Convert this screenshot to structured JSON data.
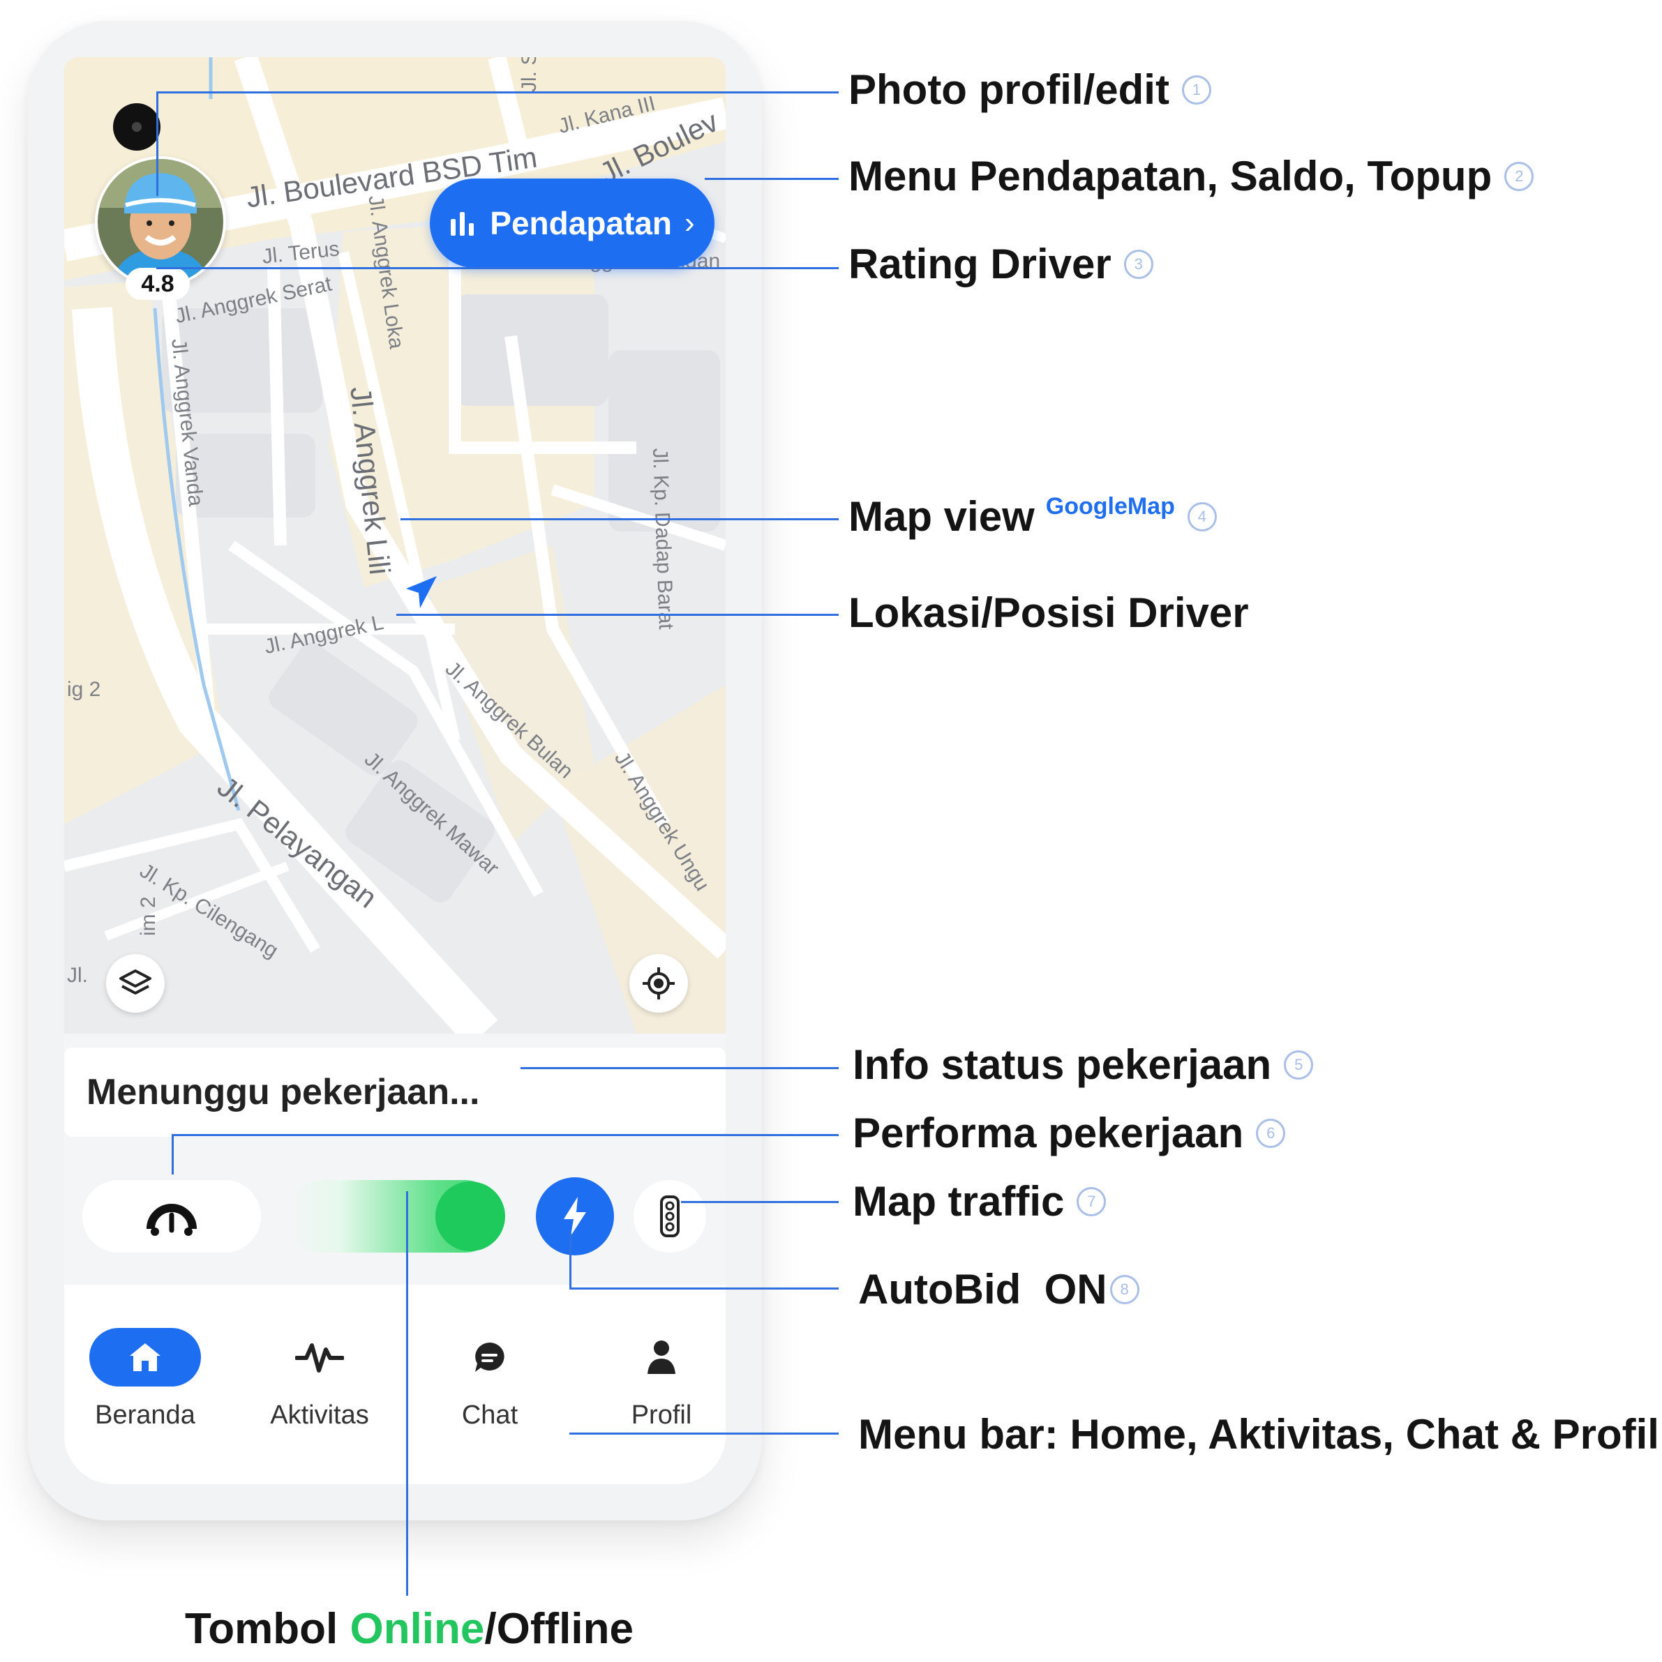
{
  "map": {
    "streets": [
      "Jl. Kana III",
      "Jl. Boulevard BSD Tim",
      "Jl. Boulev",
      "Jl. S",
      "Jl. Terus",
      "Jl. Anggrek Pandan",
      "Jl. Anggrek Serat",
      "Jl. Anggrek Loka",
      "Jl. Anggrek Vanda",
      "Jl. Anggrek Lili",
      "Jl. Kp. Dadap Barat",
      "Jl. Anggrek L",
      "Jl. Anggrek Bulan",
      "Jl. Anggrek Mawar",
      "Jl. Anggrek Ungu",
      "Jl. Pelayangan",
      "Jl. Kp. Cilengang",
      "ig 2",
      "im 2",
      "Jl."
    ]
  },
  "header": {
    "rating": "4.8",
    "pendapatan_label": "Pendapatan",
    "pendapatan_chevron": "›"
  },
  "status": {
    "text": "Menunggu pekerjaan..."
  },
  "controls": {
    "online": true,
    "autobid_on": true
  },
  "nav": {
    "items": [
      {
        "label": "Beranda",
        "icon": "home-icon",
        "active": true
      },
      {
        "label": "Aktivitas",
        "icon": "activity-icon",
        "active": false
      },
      {
        "label": "Chat",
        "icon": "chat-icon",
        "active": false
      },
      {
        "label": "Profil",
        "icon": "person-icon",
        "active": false
      }
    ]
  },
  "annotations": [
    {
      "text": "Photo profil/edit",
      "num": "1"
    },
    {
      "text": "Menu Pendapatan, Saldo, Topup",
      "num": "2"
    },
    {
      "text": "Rating Driver",
      "num": "3"
    },
    {
      "text": "Map view",
      "extra": "GoogleMap",
      "num": "4"
    },
    {
      "text": "Lokasi/Posisi Driver",
      "num": ""
    },
    {
      "text": "Info status pekerjaan",
      "num": "5"
    },
    {
      "text": "Performa pekerjaan",
      "num": "6"
    },
    {
      "text": "Map traffic",
      "num": "7"
    },
    {
      "text": "AutoBid  ON",
      "num": "8"
    },
    {
      "text": "Menu bar: Home, Aktivitas, Chat & Profil",
      "num": ""
    }
  ],
  "caption": {
    "prefix": "Tombol ",
    "online": "Online",
    "suffix": "/Offline"
  },
  "colors": {
    "accent": "#1e6ef2",
    "online_green": "#22c55e",
    "annotation_line": "#2f6fe0"
  }
}
